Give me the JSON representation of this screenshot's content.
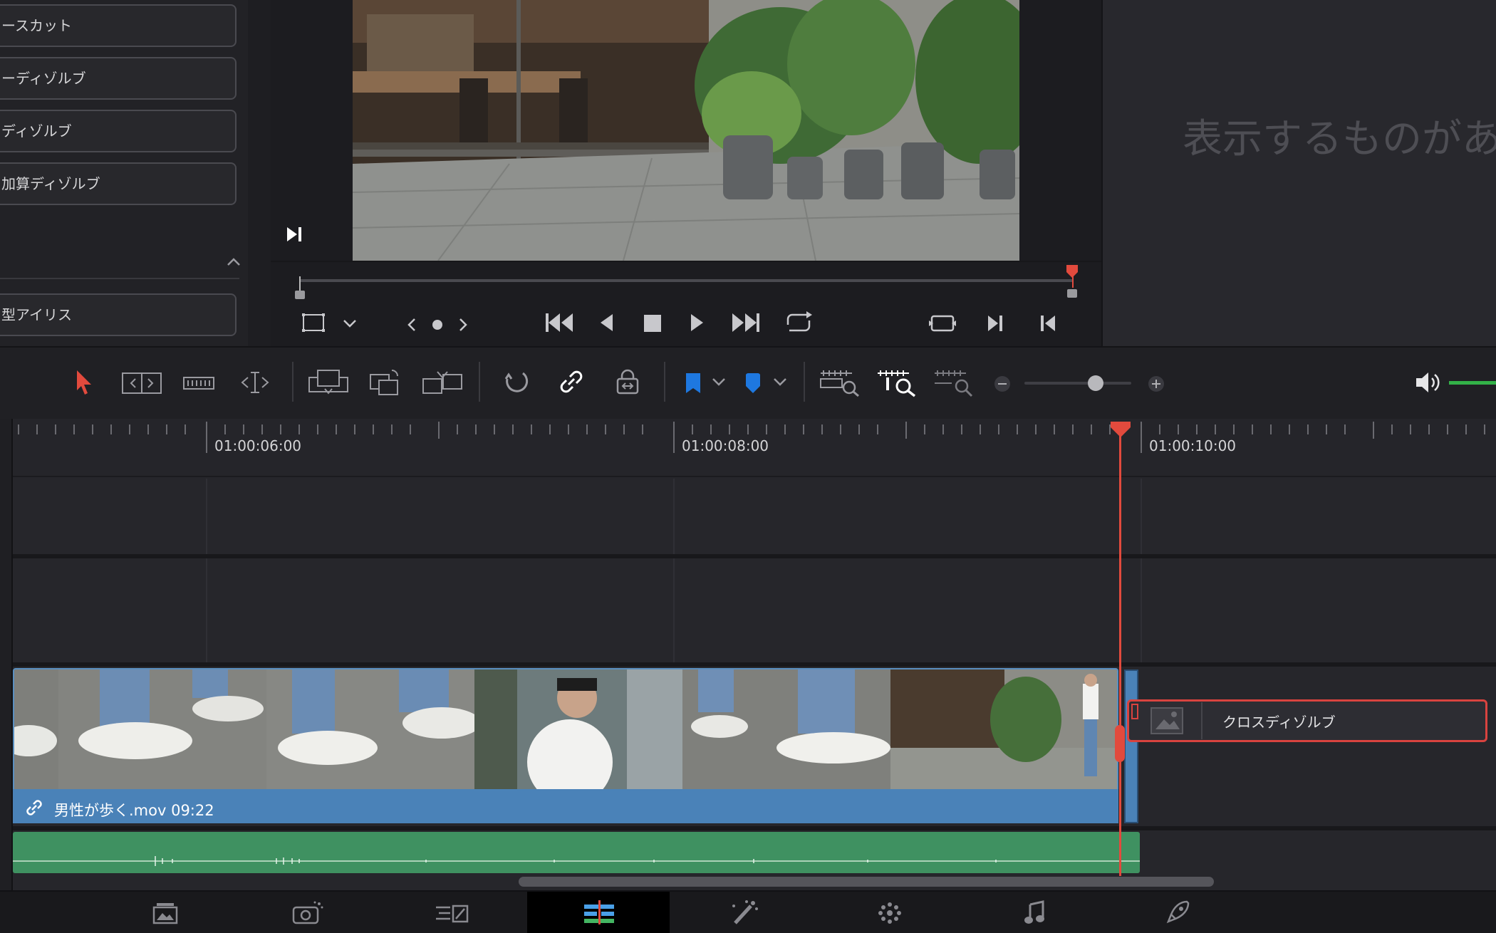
{
  "transitions": {
    "items": [
      {
        "label": "ースカット"
      },
      {
        "label": "ーディゾルブ"
      },
      {
        "label": "ディゾルブ"
      },
      {
        "label": "加算ディゾルブ"
      },
      {
        "label": "型アイリス"
      }
    ]
  },
  "viewer": {
    "empty_message": "表示するものがあり"
  },
  "timeline": {
    "timecodes": [
      "01:00:06:00",
      "01:00:08:00",
      "01:00:10:00"
    ],
    "clip_name": "男性が歩く.mov  09:22",
    "transition_name": "クロスディゾルブ"
  },
  "icons": {
    "toolbar": [
      "select-pointer-icon",
      "trim-edit-icon",
      "dynamic-trim-icon",
      "blade-icon",
      "overwrite-icon",
      "replace-icon",
      "place-on-top-icon",
      "snapping-icon",
      "linked-selection-icon",
      "position-lock-icon",
      "flag-icon",
      "marker-icon",
      "zoom-full-icon",
      "zoom-detail-icon",
      "zoom-custom-icon",
      "zoom-out-icon",
      "zoom-in-icon",
      "volume-icon"
    ],
    "pages": [
      "media-page-icon",
      "cut-page-icon",
      "edit-page-icon",
      "fusion-page-icon",
      "color-page-icon",
      "fairlight-page-icon",
      "deliver-page-icon"
    ]
  },
  "colors": {
    "accent_red": "#e24a3d",
    "clip_blue": "#4a82b8",
    "audio_green": "#3f9161",
    "marker_blue": "#1e78e0"
  }
}
